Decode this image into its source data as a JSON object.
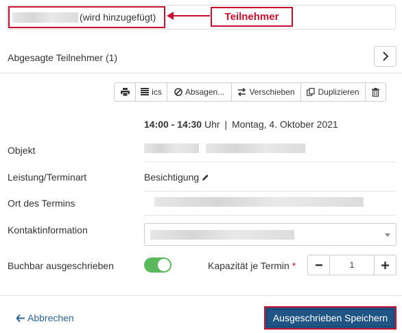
{
  "participant_field": {
    "hint": "(wird hinzugefügt)"
  },
  "annotation": {
    "label": "Teilnehmer",
    "color": "#c8102e"
  },
  "canceled": {
    "label": "Abgesagte Teilnehmer (1)",
    "icon": "chevron-right-icon"
  },
  "toolbar": {
    "buttons": [
      {
        "icon": "print-icon",
        "label": ""
      },
      {
        "icon": "calendar-list-icon",
        "label": "ics"
      },
      {
        "icon": "ban-icon",
        "label": "Absagen..."
      },
      {
        "icon": "exchange-icon",
        "label": "Verschieben"
      },
      {
        "icon": "copy-icon",
        "label": "Duplizieren"
      },
      {
        "icon": "trash-icon",
        "label": ""
      }
    ]
  },
  "time": {
    "range": "14:00 - 14:30",
    "unit": "Uhr",
    "separator": "|",
    "date": "Montag, 4. Oktober 2021"
  },
  "rows": {
    "object_label": "Objekt",
    "service_label": "Leistung/Terminart",
    "service_value": "Besichtigung",
    "service_icon": "pencil-icon",
    "location_label": "Ort des Termins",
    "contact_label": "Kontaktinformation",
    "bookable_label": "Buchbar ausgeschrieben",
    "bookable_on": true,
    "capacity_label": "Kapazität je Termin",
    "capacity_required": "*",
    "capacity_value": "1"
  },
  "footer": {
    "cancel_label": "Abbrechen",
    "save_label": "Ausgeschrieben Speichern"
  },
  "colors": {
    "accent_red": "#c8102e",
    "primary": "#1f5584",
    "toggle_green": "#5cb85c",
    "link": "#2a6496"
  }
}
